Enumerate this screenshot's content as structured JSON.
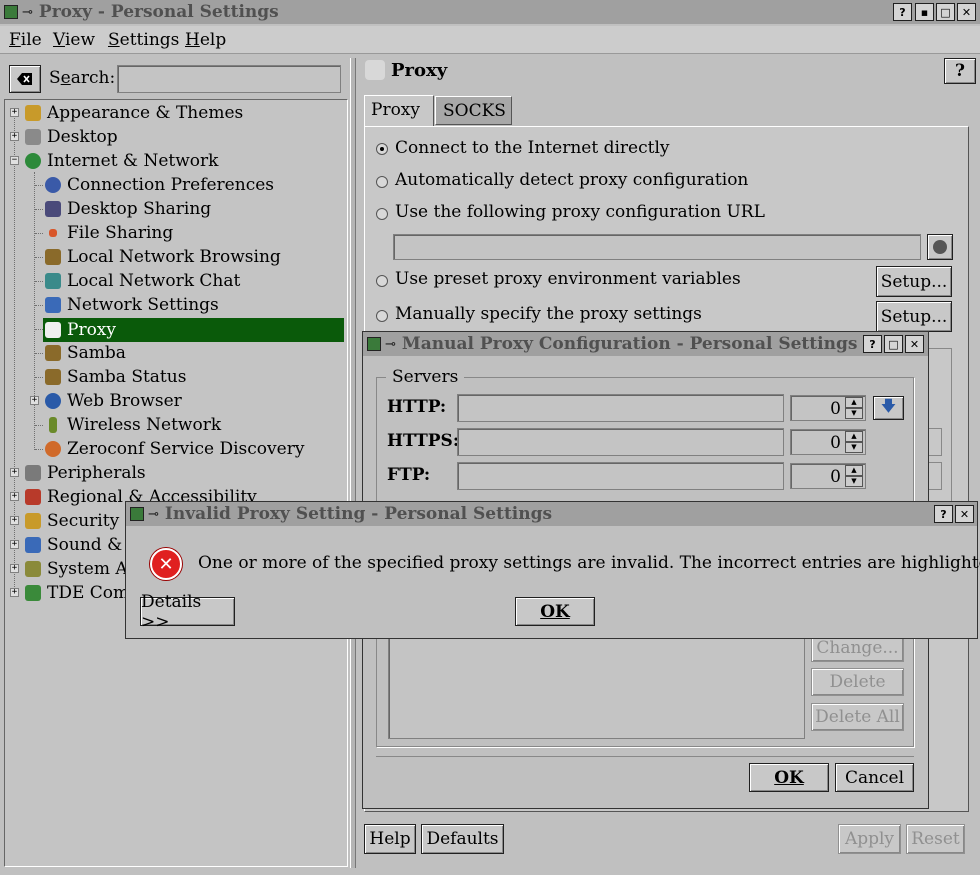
{
  "window": {
    "title": "Proxy - Personal Settings"
  },
  "menubar": [
    {
      "label": "File",
      "u": "F",
      "rest": "ile"
    },
    {
      "label": "View",
      "u": "V",
      "rest": "iew"
    },
    {
      "label": "Settings",
      "u": "S",
      "rest": "ettings"
    },
    {
      "label": "Help",
      "u": "H",
      "rest": "elp"
    }
  ],
  "search": {
    "label_pre": "S",
    "label_u": "e",
    "label_post": "arch:",
    "value": ""
  },
  "tree": {
    "top": [
      {
        "label": "Appearance & Themes",
        "icon": "appearance-icon",
        "color": "#c89a2a"
      },
      {
        "label": "Desktop",
        "icon": "desktop-icon",
        "color": "#8a8a8a"
      },
      {
        "label": "Internet & Network",
        "icon": "globe-icon",
        "color": "#2d8a3a"
      }
    ],
    "children": [
      {
        "label": "Connection Preferences",
        "icon": "connection-icon",
        "color": "#3a5aa8"
      },
      {
        "label": "Desktop Sharing",
        "icon": "desktop-sharing-icon",
        "color": "#4a4a7a"
      },
      {
        "label": "File Sharing",
        "icon": "file-sharing-icon",
        "color": "#d8562a"
      },
      {
        "label": "Local Network Browsing",
        "icon": "network-browsing-icon",
        "color": "#8a6a2a"
      },
      {
        "label": "Local Network Chat",
        "icon": "network-chat-icon",
        "color": "#3a8a8a"
      },
      {
        "label": "Network Settings",
        "icon": "network-settings-icon",
        "color": "#3a6ab8"
      },
      {
        "label": "Proxy",
        "icon": "proxy-icon",
        "color": "#f0f0f0"
      },
      {
        "label": "Samba",
        "icon": "samba-icon",
        "color": "#8a6a2a"
      },
      {
        "label": "Samba Status",
        "icon": "samba-status-icon",
        "color": "#8a6a2a"
      },
      {
        "label": "Web Browser",
        "icon": "web-browser-icon",
        "color": "#2a5aa8"
      },
      {
        "label": "Wireless Network",
        "icon": "wireless-icon",
        "color": "#6a8a2a"
      },
      {
        "label": "Zeroconf Service Discovery",
        "icon": "zeroconf-icon",
        "color": "#d06a2a"
      }
    ],
    "bottom": [
      {
        "label": "Peripherals",
        "icon": "peripherals-icon",
        "color": "#7a7a7a"
      },
      {
        "label": "Regional & Accessibility",
        "icon": "regional-icon",
        "color": "#b83a2a"
      },
      {
        "label": "Security &",
        "icon": "security-icon",
        "color": "#c89a2a"
      },
      {
        "label": "Sound & M",
        "icon": "sound-icon",
        "color": "#3a6ab8"
      },
      {
        "label": "System Ad",
        "icon": "system-admin-icon",
        "color": "#8a8a3a"
      },
      {
        "label": "TDE Comp",
        "icon": "tde-components-icon",
        "color": "#3a8a3a"
      }
    ],
    "selected": "Proxy"
  },
  "panel": {
    "title": "Proxy",
    "tabs": [
      {
        "label": "Proxy"
      },
      {
        "label": "SOCKS"
      }
    ],
    "options": [
      {
        "label": "Connect to the Internet directly",
        "selected": true
      },
      {
        "label": "Automatically detect proxy configuration",
        "selected": false
      },
      {
        "label": "Use the following proxy configuration URL",
        "selected": false
      },
      {
        "label": "Use preset proxy environment variables",
        "selected": false
      },
      {
        "label": "Manually specify the proxy settings",
        "selected": false
      }
    ],
    "setup_label": "Setup...",
    "bottom_buttons": {
      "help": "Help",
      "defaults": "Defaults",
      "apply": "Apply",
      "reset": "Reset"
    }
  },
  "manual_dialog": {
    "title": "Manual Proxy Configuration - Personal Settings",
    "servers_label": "Servers",
    "rows": [
      {
        "label": "HTTP:",
        "value": "",
        "port": "0"
      },
      {
        "label": "HTTPS:",
        "value": "",
        "port": "0"
      },
      {
        "label": "FTP:",
        "value": "",
        "port": "0"
      }
    ],
    "side_buttons": {
      "change": "Change...",
      "delete": "Delete",
      "delete_all": "Delete All"
    },
    "ok": "OK",
    "cancel": "Cancel"
  },
  "error_dialog": {
    "title": "Invalid Proxy Setting - Personal Settings",
    "message": "One or more of the specified proxy settings are invalid. The incorrect entries are highlighted.",
    "details": "Details >>",
    "ok": "OK"
  },
  "colors": {
    "selection": "#0a5a0a",
    "error": "#e02020"
  }
}
